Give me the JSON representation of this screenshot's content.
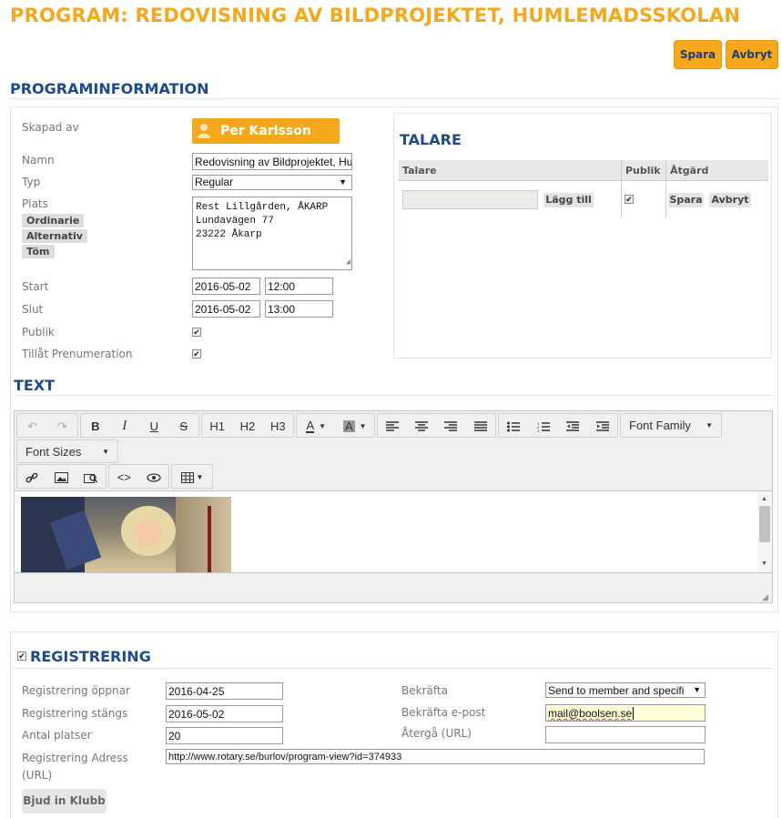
{
  "title": "PROGRAM: REDOVISNING AV BILDPROJEKTET, HUMLEMADSSKOLAN",
  "actions": {
    "save": "Spara",
    "cancel": "Avbryt"
  },
  "programinfo": {
    "heading": "PROGRAMINFORMATION",
    "created_by_label": "Skapad av",
    "created_by": "Per Karlsson",
    "name_label": "Namn",
    "name_value": "Redovisning av Bildprojektet, Humlemadsskolan",
    "type_label": "Typ",
    "type_value": "Regular",
    "place_label": "Plats",
    "place_tags": [
      "Ordinarie",
      "Alternativ",
      "Töm"
    ],
    "place_lines": [
      "Rest Lillgården, ÅKARP",
      "Lundavägen 77",
      "23222 Åkarp"
    ],
    "start_label": "Start",
    "start_date": "2016-05-02",
    "start_time": "12:00",
    "end_label": "Slut",
    "end_date": "2016-05-02",
    "end_time": "13:00",
    "public_label": "Publik",
    "subscription_label": "Tillåt Prenumeration"
  },
  "speakers": {
    "heading": "TALARE",
    "col_speaker": "Talare",
    "col_public": "Publik",
    "col_action": "Åtgärd",
    "add_label": "Lägg till",
    "save_label": "Spara",
    "cancel_label": "Avbryt"
  },
  "text_section": {
    "heading": "TEXT",
    "toolbar": {
      "h1": "H1",
      "h2": "H2",
      "h3": "H3",
      "font_family": "Font Family",
      "font_sizes": "Font Sizes"
    }
  },
  "registration": {
    "heading": "REGISTRERING",
    "opens_label": "Registrering öppnar",
    "opens_value": "2016-04-25",
    "closes_label": "Registrering stängs",
    "closes_value": "2016-05-02",
    "seats_label": "Antal platser",
    "seats_value": "20",
    "address_label_1": "Registrering Adress",
    "address_label_2": "(URL)",
    "address_value": "http://www.rotary.se/burlov/program-view?id=374933",
    "confirm_label": "Bekräfta",
    "confirm_value": "Send to member and specifi",
    "confirm_email_label": "Bekräfta e-post",
    "confirm_email_value": "mail@boolsen.se",
    "return_label": "Återgå (URL)",
    "return_value": "",
    "invite_button": "Bjud in Klubb"
  },
  "colors": {
    "accent": "#f6a81c",
    "heading_blue": "#1f4a8a"
  }
}
